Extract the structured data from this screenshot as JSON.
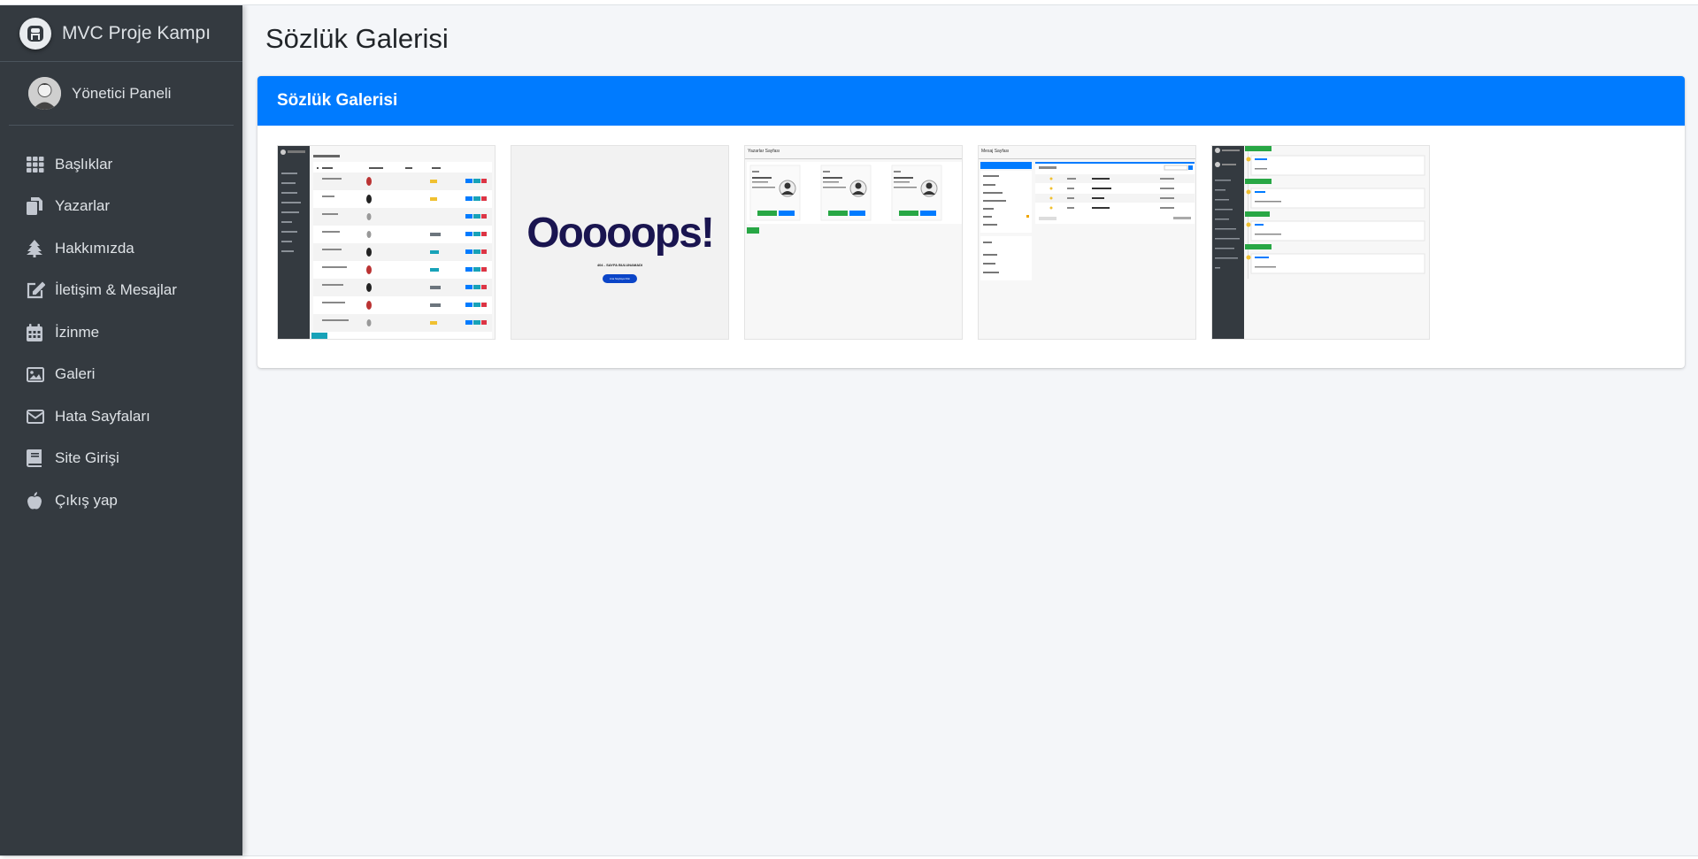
{
  "brand": {
    "title": "MVC Proje Kampı"
  },
  "user": {
    "name": "Yönetici Paneli"
  },
  "nav": [
    {
      "label": "Başlıklar",
      "icon": "grid-icon"
    },
    {
      "label": "Yazarlar",
      "icon": "copy-icon"
    },
    {
      "label": "Hakkımızda",
      "icon": "tree-icon"
    },
    {
      "label": "İletişim & Mesajlar",
      "icon": "edit-icon"
    },
    {
      "label": "İzinme",
      "icon": "calendar-icon"
    },
    {
      "label": "Galeri",
      "icon": "image-icon"
    },
    {
      "label": "Hata Sayfaları",
      "icon": "envelope-icon"
    },
    {
      "label": "Site Girişi",
      "icon": "book-icon"
    },
    {
      "label": "Çıkış yap",
      "icon": "apple-icon"
    }
  ],
  "page": {
    "title": "Sözlük Galerisi"
  },
  "card": {
    "title": "Sözlük Galerisi"
  },
  "gallery": {
    "thumbs": [
      {
        "name": "headings-table-screenshot"
      },
      {
        "name": "error-404-screenshot",
        "text": "Ooooops!",
        "subtext": "404 - SAYFA BULUNAMADI",
        "button": "Ana Sayfaya Dön"
      },
      {
        "name": "writers-cards-screenshot",
        "title": "Yazarlar Sayfası"
      },
      {
        "name": "messages-inbox-screenshot",
        "title": "Mesaj Sayfası"
      },
      {
        "name": "timeline-screenshot"
      }
    ]
  },
  "colors": {
    "sidebar": "#343a40",
    "accent": "#007bff",
    "background": "#f4f6f9"
  }
}
